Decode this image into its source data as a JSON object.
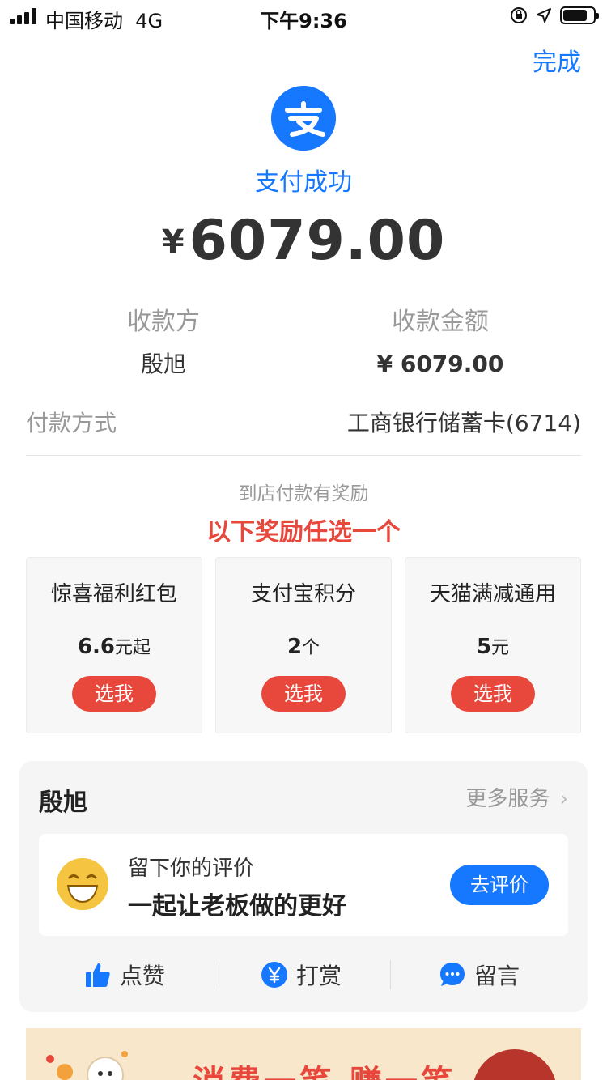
{
  "status_bar": {
    "carrier": "中国移动",
    "network": "4G",
    "time": "下午9:36",
    "battery_level": 0.8
  },
  "header": {
    "done_label": "完成"
  },
  "result": {
    "status": "支付成功",
    "currency_symbol": "¥",
    "amount": "6079.00"
  },
  "payee": {
    "label": "收款方",
    "value": "殷旭"
  },
  "received": {
    "label": "收款金额",
    "value": "¥ 6079.00"
  },
  "payment_method": {
    "label": "付款方式",
    "value": "工商银行储蓄卡(6714)"
  },
  "rewards": {
    "subtitle": "到店付款有奖励",
    "title": "以下奖励任选一个",
    "items": [
      {
        "title": "惊喜福利红包",
        "number": "6.6",
        "unit": "元起",
        "button": "选我"
      },
      {
        "title": "支付宝积分",
        "number": "2",
        "unit": "个",
        "button": "选我"
      },
      {
        "title": "天猫满减通用",
        "number": "5",
        "unit": "元",
        "button": "选我"
      }
    ]
  },
  "shop": {
    "name": "殷旭",
    "more_services": "更多服务",
    "review_line1": "留下你的评价",
    "review_line2": "一起让老板做的更好",
    "review_button": "去评价",
    "actions": [
      {
        "label": "点赞",
        "icon": "thumbs-up-icon"
      },
      {
        "label": "打赏",
        "icon": "yen-coin-icon"
      },
      {
        "label": "留言",
        "icon": "chat-bubble-icon"
      }
    ]
  },
  "banner": {
    "text": "消费一笔 赚一笔"
  },
  "colors": {
    "brand_blue": "#1677ff",
    "reward_red": "#e8483c",
    "banner_bg": "#f9e7cc"
  }
}
